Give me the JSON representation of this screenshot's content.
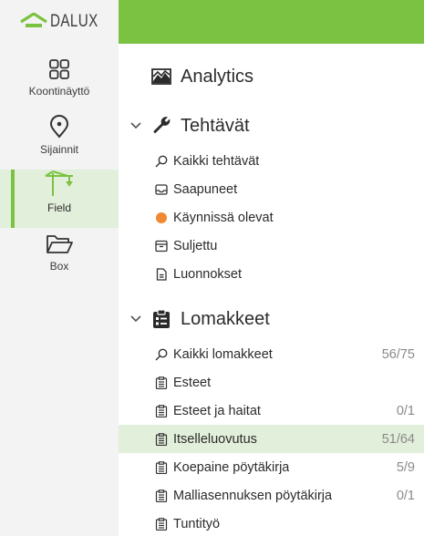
{
  "brand": {
    "logo_text": "DALUX",
    "accent": "#7cc242",
    "active_bg": "#e2efdb"
  },
  "sidebar": {
    "items": [
      {
        "label": "Koontinäyttö",
        "icon": "dashboard-grid-icon"
      },
      {
        "label": "Sijainnit",
        "icon": "location-pin-icon"
      },
      {
        "label": "Field",
        "icon": "crane-icon",
        "active": true
      },
      {
        "label": "Box",
        "icon": "folder-open-icon"
      }
    ]
  },
  "nav": {
    "analytics": {
      "label": "Analytics",
      "icon": "chart-area-icon"
    },
    "tasks": {
      "label": "Tehtävät",
      "icon": "wrench-icon",
      "items": [
        {
          "label": "Kaikki tehtävät",
          "icon": "search-icon"
        },
        {
          "label": "Saapuneet",
          "icon": "inbox-icon"
        },
        {
          "label": "Käynnissä olevat",
          "icon": "orange-dot-icon"
        },
        {
          "label": "Suljettu",
          "icon": "archive-box-icon"
        },
        {
          "label": "Luonnokset",
          "icon": "draft-document-icon"
        }
      ]
    },
    "forms": {
      "label": "Lomakkeet",
      "icon": "clipboard-icon",
      "items": [
        {
          "label": "Kaikki lomakkeet",
          "icon": "search-icon",
          "count": "56/75"
        },
        {
          "label": "Esteet",
          "icon": "form-clipboard-icon",
          "count": ""
        },
        {
          "label": "Esteet ja haitat",
          "icon": "form-clipboard-icon",
          "count": "0/1"
        },
        {
          "label": "Itselleluovutus",
          "icon": "form-clipboard-icon",
          "count": "51/64",
          "selected": true
        },
        {
          "label": "Koepaine pöytäkirja",
          "icon": "form-clipboard-icon",
          "count": "5/9"
        },
        {
          "label": "Malliasennuksen pöytäkirja",
          "icon": "form-clipboard-icon",
          "count": "0/1"
        },
        {
          "label": "Tuntityö",
          "icon": "form-clipboard-icon",
          "count": ""
        }
      ]
    }
  }
}
